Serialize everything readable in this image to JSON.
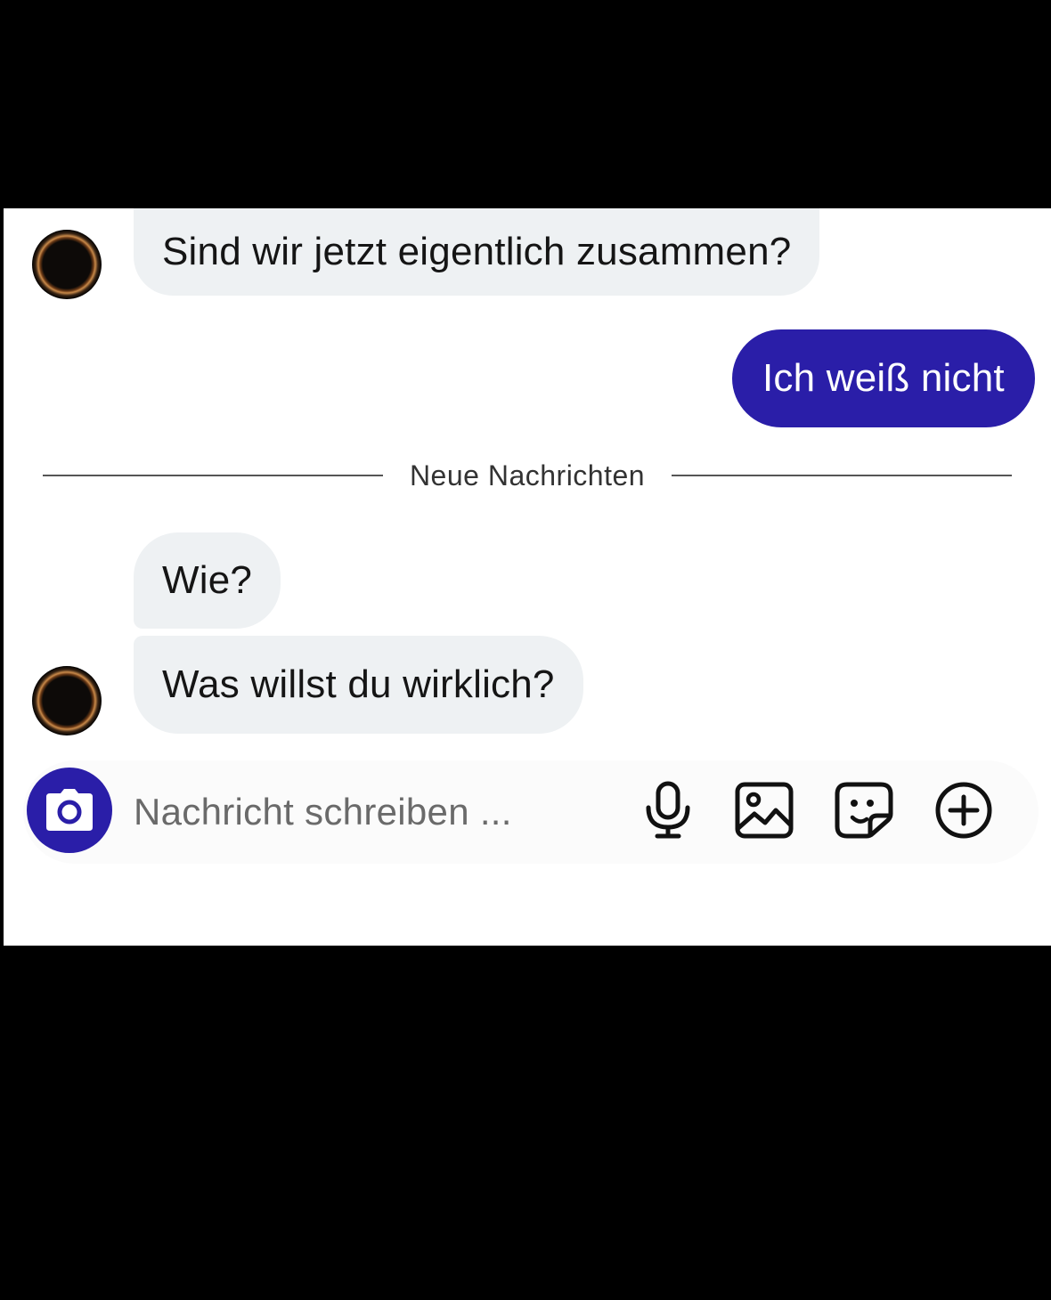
{
  "messages": [
    {
      "direction": "incoming",
      "text": "Sind wir jetzt eigentlich zusammen?"
    },
    {
      "direction": "outgoing",
      "text": "Ich weiß nicht"
    },
    {
      "direction": "incoming",
      "text": "Wie?"
    },
    {
      "direction": "incoming",
      "text": "Was willst du wirklich?"
    }
  ],
  "divider": {
    "label": "Neue Nachrichten"
  },
  "composer": {
    "placeholder": "Nachricht schreiben ...",
    "icons": [
      "camera-icon",
      "microphone-icon",
      "image-icon",
      "sticker-icon",
      "plus-circle-icon"
    ]
  },
  "colors": {
    "accent": "#2a1ea8",
    "incoming_bubble": "#eef1f3",
    "background": "#ffffff",
    "letterbox": "#000000"
  }
}
